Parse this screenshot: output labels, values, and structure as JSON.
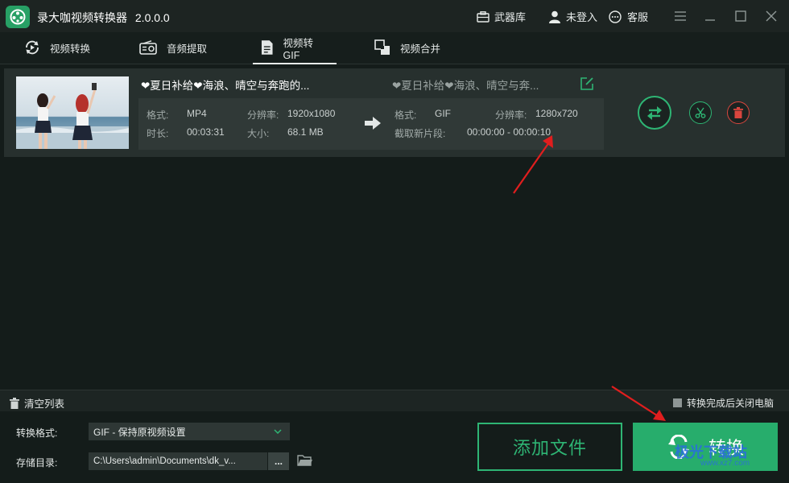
{
  "app": {
    "title": "录大咖视频转换器",
    "version": "2.0.0.0"
  },
  "titlebar": {
    "arsenal": "武器库",
    "login": "未登入",
    "service": "客服"
  },
  "tabs": [
    {
      "label": "视频转换",
      "icon": "video-convert-icon"
    },
    {
      "label": "音频提取",
      "icon": "radio-icon"
    },
    {
      "label": "视频转GIF",
      "icon": "document-icon",
      "active": true
    },
    {
      "label": "视频合并",
      "icon": "merge-icon"
    }
  ],
  "item": {
    "source_name": "❤夏日补给❤海浪、晴空与奔跑的...",
    "output_name": "❤夏日补给❤海浪、晴空与奔...",
    "source": {
      "format_label": "格式:",
      "format": "MP4",
      "resolution_label": "分辨率:",
      "resolution": "1920x1080",
      "duration_label": "时长:",
      "duration": "00:03:31",
      "size_label": "大小:",
      "size": "68.1 MB"
    },
    "output": {
      "format_label": "格式:",
      "format": "GIF",
      "resolution_label": "分辨率:",
      "resolution": "1280x720",
      "clip_label": "截取新片段:",
      "clip": "00:00:00 - 00:00:10"
    }
  },
  "footer": {
    "clear_list": "清空列表",
    "shutdown_label": "转换完成后关闭电脑",
    "format_label": "转换格式:",
    "format_value": "GIF - 保持原视频设置",
    "dir_label": "存储目录:",
    "dir_value": "C:\\Users\\admin\\Documents\\dk_v...",
    "browse": "...",
    "add_files": "添加文件",
    "convert": "转换"
  },
  "watermark": {
    "text": "极光下载站",
    "sub": "www.xz7.com"
  },
  "colors": {
    "accent": "#27ad6c",
    "bg": "#141c1a",
    "panel": "#27302e",
    "annotation": "#e01e1e"
  }
}
